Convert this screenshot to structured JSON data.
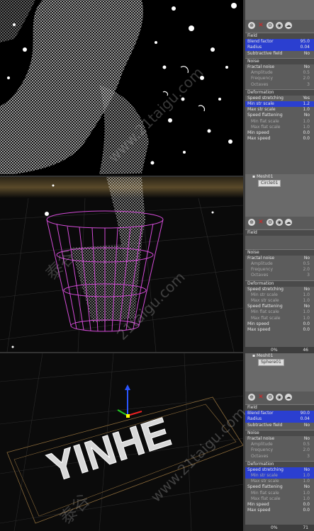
{
  "panel1": {
    "sections": [
      {
        "title": "Field",
        "rows": [
          {
            "label": "Blend factor",
            "value": "95.0",
            "hl": true
          },
          {
            "label": "Radius",
            "value": "0.04",
            "hl": true
          },
          {
            "label": "Subtractive field",
            "value": "No"
          }
        ]
      },
      {
        "title": "Noise",
        "rows": [
          {
            "label": "Fractal noise",
            "value": "No"
          },
          {
            "label": "Amplitude",
            "value": "0.5",
            "sub": true
          },
          {
            "label": "Frequency",
            "value": "2.0",
            "sub": true
          },
          {
            "label": "Octaves",
            "value": "3",
            "sub": true
          }
        ]
      },
      {
        "title": "Deformation",
        "rows": [
          {
            "label": "Speed stretching",
            "value": "Yes"
          },
          {
            "label": "Min str scale",
            "value": "1.2",
            "hl": true
          },
          {
            "label": "Max str scale",
            "value": "1.0"
          },
          {
            "label": "Speed flattening",
            "value": "No"
          },
          {
            "label": "Min flat scale",
            "value": "1.0",
            "sub": true
          },
          {
            "label": "Max flat scale",
            "value": "1.0",
            "sub": true
          },
          {
            "label": "Min speed",
            "value": "0.0"
          },
          {
            "label": "Max speed",
            "value": "0.0"
          }
        ]
      }
    ]
  },
  "tree1": {
    "parent": "Mesh01",
    "child": "Circle01"
  },
  "panel2": {
    "sections": [
      {
        "title": "Field",
        "rows": [
          {
            "label": "",
            "value": ""
          },
          {
            "label": "",
            "value": ""
          }
        ]
      },
      {
        "title": "Noise",
        "rows": [
          {
            "label": "Fractal noise",
            "value": "No"
          },
          {
            "label": "Amplitude",
            "value": "0.5",
            "sub": true
          },
          {
            "label": "Frequency",
            "value": "2.0",
            "sub": true
          },
          {
            "label": "Octaves",
            "value": "3",
            "sub": true
          }
        ]
      },
      {
        "title": "Deformation",
        "rows": [
          {
            "label": "Speed stretching",
            "value": "No"
          },
          {
            "label": "Min str scale",
            "value": "1.0",
            "sub": true
          },
          {
            "label": "Max str scale",
            "value": "1.0",
            "sub": true
          },
          {
            "label": "Speed flattening",
            "value": "No"
          },
          {
            "label": "Min flat scale",
            "value": "1.0",
            "sub": true
          },
          {
            "label": "Max flat scale",
            "value": "1.0",
            "sub": true
          },
          {
            "label": "Min speed",
            "value": "0.0"
          },
          {
            "label": "Max speed",
            "value": "0.0"
          }
        ]
      }
    ]
  },
  "status1": {
    "left": "0%",
    "right": "46"
  },
  "tree2": {
    "parent": "Mesh01",
    "child": "Sphere01"
  },
  "panel3": {
    "sections": [
      {
        "title": "Field",
        "rows": [
          {
            "label": "Blend factor",
            "value": "90.0",
            "hl": true
          },
          {
            "label": "Radius",
            "value": "0.04",
            "hl": true
          },
          {
            "label": "Subtractive field",
            "value": "No"
          }
        ]
      },
      {
        "title": "Noise",
        "rows": [
          {
            "label": "Fractal noise",
            "value": "No"
          },
          {
            "label": "Amplitude",
            "value": "0.5",
            "sub": true
          },
          {
            "label": "Frequency",
            "value": "2.0",
            "sub": true
          },
          {
            "label": "Octaves",
            "value": "3",
            "sub": true
          }
        ]
      },
      {
        "title": "Deformation",
        "rows": [
          {
            "label": "Speed stretching",
            "value": "No",
            "hl": true
          },
          {
            "label": "Min str scale",
            "value": "1.0",
            "sub": true,
            "hl": true
          },
          {
            "label": "Max str scale",
            "value": "1.0",
            "sub": true
          },
          {
            "label": "Speed flattening",
            "value": "No"
          },
          {
            "label": "Min flat scale",
            "value": "1.0",
            "sub": true
          },
          {
            "label": "Max flat scale",
            "value": "1.0",
            "sub": true
          },
          {
            "label": "Min speed",
            "value": "0.0"
          },
          {
            "label": "Max speed",
            "value": "0.0"
          }
        ]
      }
    ]
  },
  "status2": {
    "left": "0%",
    "right": "71"
  },
  "viewport3": {
    "text": "YINHE"
  },
  "watermark": {
    "text": "www.21taigu.com",
    "text2": "21taigu.com",
    "cn": "泰谷"
  },
  "colors": {
    "highlight": "#2b3fd0",
    "glass": "#d24bd6",
    "panel": "#5c5c5c"
  }
}
